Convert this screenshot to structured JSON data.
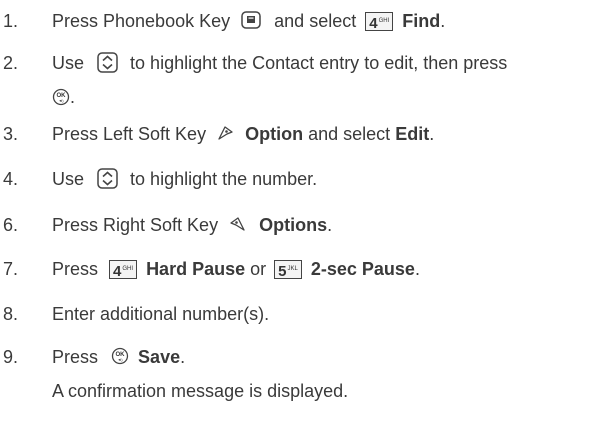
{
  "steps": [
    {
      "num": "1.",
      "pre": "Press Phonebook Key",
      "mid": "and select",
      "key": "4",
      "key_sub": "GHI",
      "bold": "Find",
      "post": "."
    },
    {
      "num": "2.",
      "pre": "Use",
      "post": "to highlight the Contact entry to edit, then press",
      "line2_post": "."
    },
    {
      "num": "3.",
      "pre": "Press Left Soft Key",
      "bold1": "Option",
      "mid": "and select",
      "bold2": "Edit",
      "post": "."
    },
    {
      "num": "4.",
      "pre": "Use",
      "post": "to highlight the number."
    },
    {
      "num": "6.",
      "pre": "Press Right Soft Key",
      "bold": "Options",
      "post": "."
    },
    {
      "num": "7.",
      "pre": "Press",
      "key1": "4",
      "key1_sub": "GHI",
      "bold1": "Hard Pause",
      "mid": "or",
      "key2": "5",
      "key2_sub": "JKL",
      "bold2": "2-sec Pause",
      "post": "."
    },
    {
      "num": "8.",
      "text": "Enter additional number(s)."
    },
    {
      "num": "9.",
      "pre": "Press",
      "bold": "Save",
      "post": ".",
      "line2": "A confirmation message is displayed."
    }
  ],
  "icons": {
    "phonebook_key": "phonebook-key-icon",
    "nav_key": "navigation-key-icon",
    "ok_key": "ok-key-icon",
    "left_soft_key": "left-soft-key-icon",
    "right_soft_key": "right-soft-key-icon"
  },
  "colors": {
    "text": "#3a3a3a",
    "icon_stroke": "#444444"
  }
}
